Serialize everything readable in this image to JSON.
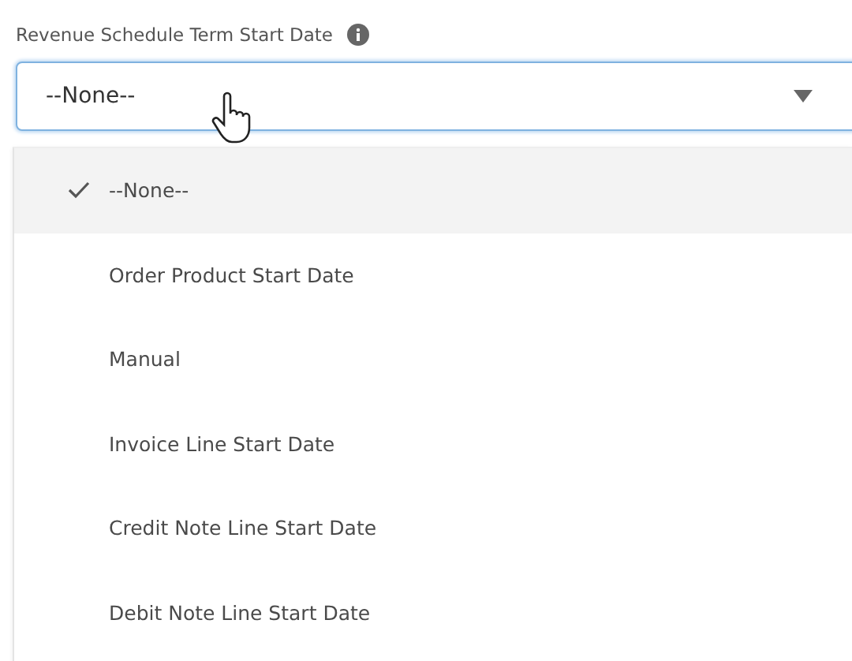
{
  "field": {
    "label": "Revenue Schedule Term Start Date",
    "value": "--None--",
    "focused": true
  },
  "options": [
    {
      "label": "--None--",
      "selected": true,
      "highlighted": true
    },
    {
      "label": "Order Product Start Date",
      "selected": false,
      "highlighted": false
    },
    {
      "label": "Manual",
      "selected": false,
      "highlighted": false
    },
    {
      "label": "Invoice Line Start Date",
      "selected": false,
      "highlighted": false
    },
    {
      "label": "Credit Note Line Start Date",
      "selected": false,
      "highlighted": false
    },
    {
      "label": "Debit Note Line Start Date",
      "selected": false,
      "highlighted": false
    }
  ]
}
